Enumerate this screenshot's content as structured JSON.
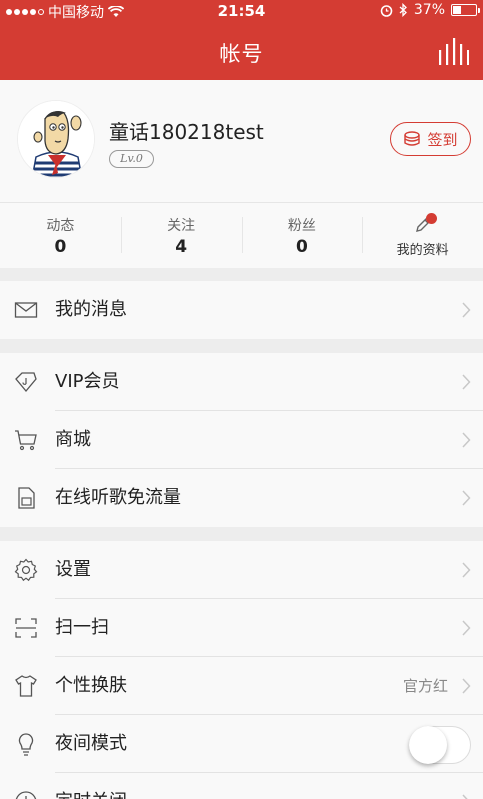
{
  "status_bar": {
    "carrier": "中国移动",
    "time": "21:54",
    "battery": "37%",
    "battery_level": 0.37
  },
  "nav": {
    "title": "帐号",
    "right_icon": "equalizer-bars-icon"
  },
  "profile": {
    "username": "童话180218test",
    "level": "Lv.0",
    "signin_label": "签到",
    "signin_icon": "coin-stack-icon"
  },
  "stats": [
    {
      "label": "动态",
      "value": "0"
    },
    {
      "label": "关注",
      "value": "4"
    },
    {
      "label": "粉丝",
      "value": "0"
    }
  ],
  "my_profile": {
    "label": "我的资料",
    "icon": "pencil-icon"
  },
  "groups": {
    "messages": [
      {
        "label": "我的消息",
        "icon": "envelope-icon"
      }
    ],
    "services": [
      {
        "label": "VIP会员",
        "icon": "diamond-icon"
      },
      {
        "label": "商城",
        "icon": "cart-icon"
      },
      {
        "label": "在线听歌免流量",
        "icon": "sim-card-icon"
      }
    ],
    "settings": [
      {
        "label": "设置",
        "icon": "gear-icon"
      },
      {
        "label": "扫一扫",
        "icon": "scan-icon"
      },
      {
        "label": "个性换肤",
        "icon": "tshirt-icon",
        "value": "官方红"
      },
      {
        "label": "夜间模式",
        "icon": "lightbulb-icon",
        "toggle_on": false
      },
      {
        "label": "定时关闭",
        "icon": "clock-icon"
      }
    ]
  },
  "colors": {
    "brand_red": "#d43c33",
    "background": "#ededed",
    "card": "#f9f9f9"
  }
}
